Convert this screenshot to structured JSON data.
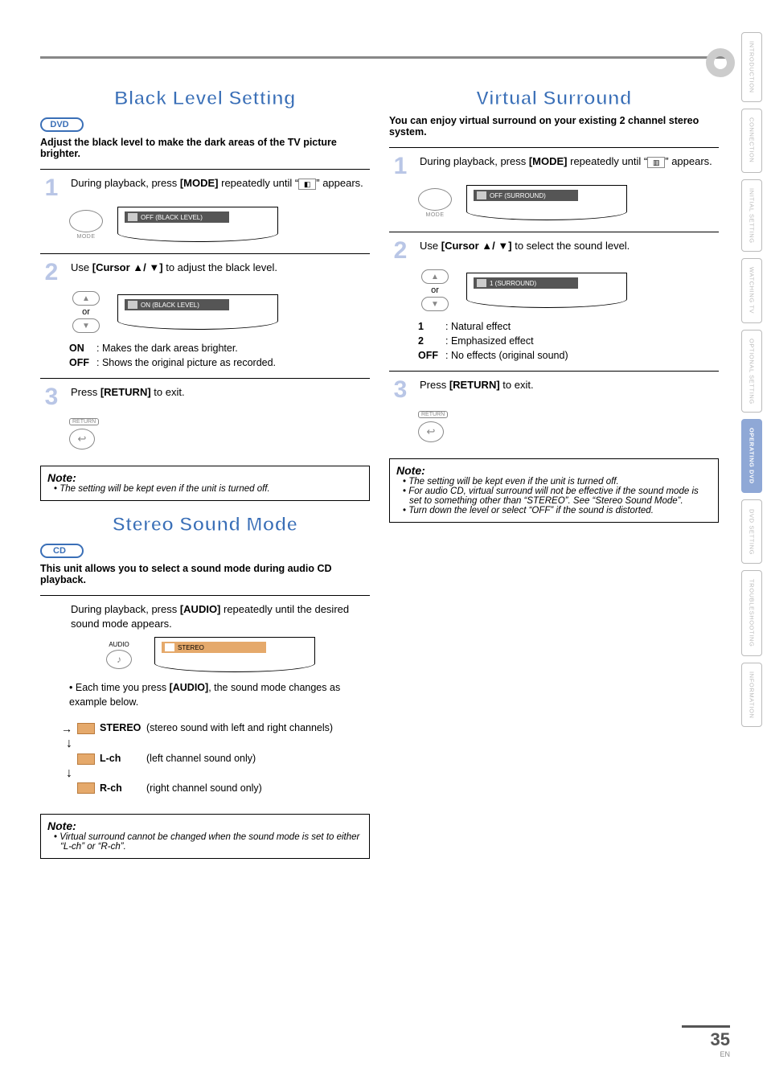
{
  "page": {
    "number": "35",
    "lang": "EN"
  },
  "side_tabs": [
    "INTRODUCTION",
    "CONNECTION",
    "INITIAL SETTING",
    "WATCHING TV",
    "OPTIONAL SETTING",
    "OPERATING DVD",
    "DVD SETTING",
    "TROUBLESHOOTING",
    "INFORMATION"
  ],
  "side_tab_active_index": 5,
  "black_level": {
    "heading": "Black Level Setting",
    "badge": "DVD",
    "intro": "Adjust the black level to make the dark areas of the TV picture brighter.",
    "step1_a": "During playback, press ",
    "step1_key": "[MODE]",
    "step1_b": " repeatedly until “",
    "step1_c": "” appears.",
    "mode_label": "MODE",
    "osd1": "OFF  (BLACK LEVEL)",
    "step2_a": "Use ",
    "step2_key": "[Cursor ▲/ ▼]",
    "step2_b": " to adjust the black level.",
    "or": "or",
    "osd2": "ON  (BLACK LEVEL)",
    "defs": [
      {
        "term": "ON",
        "desc": ": Makes the dark areas brighter."
      },
      {
        "term": "OFF",
        "desc": ": Shows the original picture as recorded."
      }
    ],
    "step3_a": "Press ",
    "step3_key": "[RETURN]",
    "step3_b": " to exit.",
    "return_label": "RETURN",
    "note_title": "Note:",
    "notes": [
      "The setting will be kept even if the unit is turned off."
    ]
  },
  "stereo": {
    "heading": "Stereo Sound Mode",
    "badge": "CD",
    "intro": "This unit allows you to select a sound mode during audio CD playback.",
    "step_a": "During playback, press ",
    "step_key": "[AUDIO]",
    "step_b": " repeatedly until the desired sound mode appears.",
    "audio_label": "AUDIO",
    "osd": "STEREO",
    "bullet_a": "Each time you press ",
    "bullet_key": "[AUDIO]",
    "bullet_b": ", the sound mode changes as example below.",
    "modes": [
      {
        "label": "STEREO",
        "desc": "(stereo sound with left and right channels)"
      },
      {
        "label": "L-ch",
        "desc": "(left channel sound only)"
      },
      {
        "label": "R-ch",
        "desc": "(right channel sound only)"
      }
    ],
    "note_title": "Note:",
    "notes": [
      "Virtual surround cannot be changed when the sound mode is set to either “L-ch” or “R-ch”."
    ]
  },
  "virtual": {
    "heading": "Virtual Surround",
    "intro": "You can enjoy virtual surround on your existing 2 channel stereo system.",
    "step1_a": "During playback, press ",
    "step1_key": "[MODE]",
    "step1_b": " repeatedly until “",
    "step1_c": "” appears.",
    "mode_label": "MODE",
    "osd1": "OFF  (SURROUND)",
    "step2_a": "Use ",
    "step2_key": "[Cursor ▲/ ▼]",
    "step2_b": " to select the sound level.",
    "or": "or",
    "osd2": "1  (SURROUND)",
    "defs": [
      {
        "term": "1",
        "desc": ": Natural effect"
      },
      {
        "term": "2",
        "desc": ": Emphasized effect"
      },
      {
        "term": "OFF",
        "desc": ": No effects (original sound)"
      }
    ],
    "step3_a": "Press ",
    "step3_key": "[RETURN]",
    "step3_b": " to exit.",
    "return_label": "RETURN",
    "note_title": "Note:",
    "notes": [
      "The setting will be kept even if the unit is turned off.",
      "For audio CD, virtual surround will not be effective if the sound mode is set to something other than “STEREO”. See “Stereo Sound Mode”.",
      "Turn down the level or select “OFF” if the sound is distorted."
    ]
  }
}
